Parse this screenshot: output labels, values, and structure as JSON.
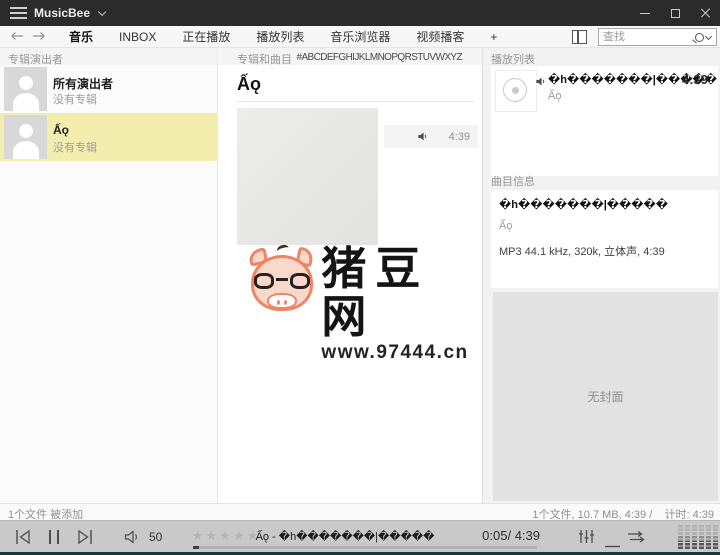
{
  "titlebar": {
    "app_title": "MusicBee"
  },
  "nav": {
    "tabs": [
      {
        "label": "音乐"
      },
      {
        "label": "INBOX"
      },
      {
        "label": "正在播放"
      },
      {
        "label": "播放列表"
      },
      {
        "label": "音乐浏览器"
      },
      {
        "label": "视频播客"
      },
      {
        "label": "+"
      }
    ],
    "active_tab": "音乐",
    "search_placeholder": "查找"
  },
  "left_panel": {
    "header": "专辑演出者",
    "items": [
      {
        "title": "所有演出者",
        "subtitle": "没有专辑"
      },
      {
        "title": "Ấǫ",
        "subtitle": "没有专辑"
      }
    ],
    "selected_item": "Ấǫ"
  },
  "center_panel": {
    "header": "专辑和曲目",
    "alphabet": "#ABCDEFGHIJKLMNOPQRSTUVWXYZ",
    "artist_heading": "Ấǫ",
    "track_duration": "4:39"
  },
  "right_panel": {
    "playlist_header": "播放列表",
    "playlist_item": {
      "title": "�h�������|�����",
      "artist": "Ấǫ",
      "duration": "4:39"
    },
    "info_header": "曲目信息",
    "track_info": {
      "title": "�h�������|�����",
      "artist": "Ấǫ",
      "format": "MP3 44.1 kHz, 320k, 立体声, 4:39"
    },
    "no_cover_label": "无封面"
  },
  "watermark": {
    "site_name": "猪豆网",
    "site_url": "www.97444.cn"
  },
  "status_bar": {
    "left": "1个文件 被添加",
    "right": "1个文件, 10.7 MB, 4:39 /    计时: 4:39"
  },
  "player": {
    "volume": "50",
    "rating_stars": "★★★★★",
    "now_playing": "Ấǫ - �h�������|�����",
    "time": "0:05/ 4:39",
    "progress_percent": 1.8
  },
  "colors": {
    "titlebar_bg": "#2b2b2b",
    "selection_yellow": "#f3edae",
    "player_bar_bg": "#c9c9c9",
    "window_bottom_border": "#17383c"
  }
}
